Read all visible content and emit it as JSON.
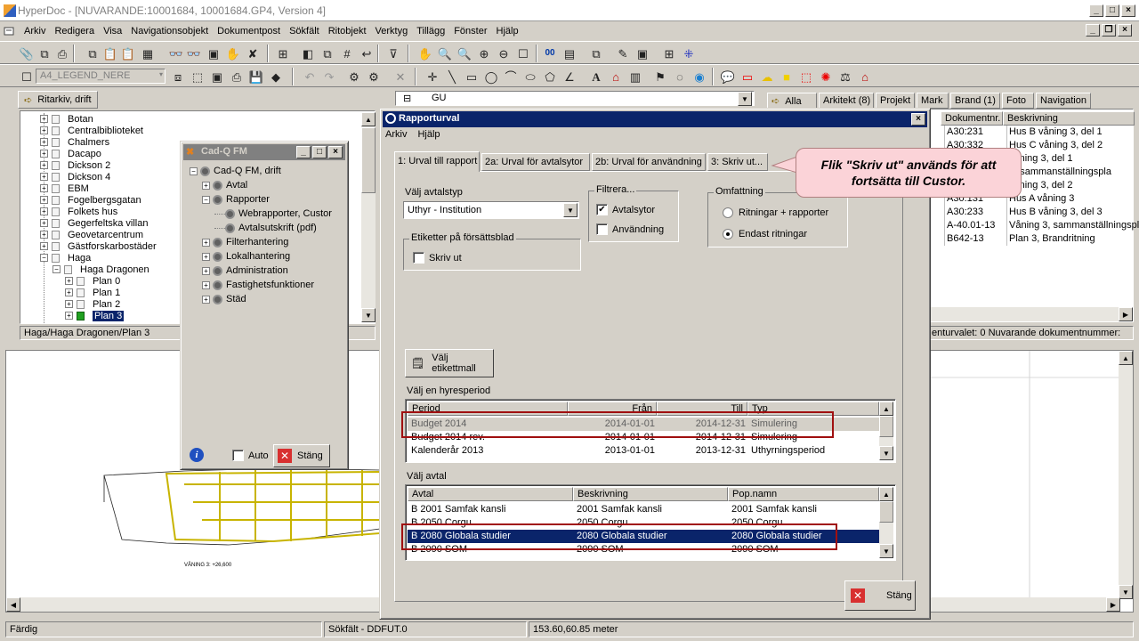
{
  "window": {
    "title": "HyperDoc - [NUVARANDE:10001684, 10001684.GP4, Version 4]"
  },
  "menu": [
    "Arkiv",
    "Redigera",
    "Visa",
    "Navigationsobjekt",
    "Dokumentpost",
    "Sökfält",
    "Ritobjekt",
    "Verktyg",
    "Tillägg",
    "Fönster",
    "Hjälp"
  ],
  "toolbar2": {
    "layer_combo": "A4_LEGEND_NERE"
  },
  "left_panel": {
    "header": "Ritarkiv, drift",
    "tree": [
      {
        "label": "Botan",
        "level": 1
      },
      {
        "label": "Centralbiblioteket",
        "level": 1
      },
      {
        "label": "Chalmers",
        "level": 1
      },
      {
        "label": "Dacapo",
        "level": 1
      },
      {
        "label": "Dickson 2",
        "level": 1
      },
      {
        "label": "Dickson 4",
        "level": 1
      },
      {
        "label": "EBM",
        "level": 1
      },
      {
        "label": "Fogelbergsgatan",
        "level": 1
      },
      {
        "label": "Folkets hus",
        "level": 1
      },
      {
        "label": "Gegerfeltska villan",
        "level": 1
      },
      {
        "label": "Geovetarcentrum",
        "level": 1
      },
      {
        "label": "Gästforskarbostäder",
        "level": 1
      },
      {
        "label": "Haga",
        "level": 1,
        "expanded": true
      },
      {
        "label": "Haga Dragonen",
        "level": 2,
        "expanded": true
      },
      {
        "label": "Plan 0",
        "level": 3
      },
      {
        "label": "Plan 1",
        "level": 3
      },
      {
        "label": "Plan 2",
        "level": 3
      },
      {
        "label": "Plan 3",
        "level": 3,
        "selected": true
      }
    ],
    "status": "Haga/Haga Dragonen/Plan 3"
  },
  "cadq": {
    "title": "Cad-Q FM",
    "tree": [
      {
        "label": "Cad-Q FM, drift",
        "level": 0
      },
      {
        "label": "Avtal",
        "level": 1
      },
      {
        "label": "Rapporter",
        "level": 1
      },
      {
        "label": "Webrapporter, Custor",
        "level": 2
      },
      {
        "label": "Avtalsutskrift (pdf)",
        "level": 2
      },
      {
        "label": "Filterhantering",
        "level": 1
      },
      {
        "label": "Lokalhantering",
        "level": 1
      },
      {
        "label": "Administration",
        "level": 1
      },
      {
        "label": "Fastighetsfunktioner",
        "level": 1
      },
      {
        "label": "Städ",
        "level": 1
      }
    ],
    "auto_label": "Auto",
    "close_label": "Stäng"
  },
  "right_panel": {
    "combo_value": "GU",
    "tabs": [
      "Alla",
      "Arkitekt (8)",
      "Projekt",
      "Mark",
      "Brand (1)",
      "Foto",
      "Navigation"
    ],
    "columns": [
      "Dokumentnr.",
      "Beskrivning"
    ],
    "rows": [
      [
        "A30:231",
        "Hus B våning 3, del 1"
      ],
      [
        "A30:332",
        "Hus C våning 3, del 2"
      ],
      [
        "",
        "våning 3, del 1"
      ],
      [
        "",
        "3, sammanställningspla"
      ],
      [
        "",
        "våning 3, del 2"
      ],
      [
        "A30:131",
        "Hus A våning 3"
      ],
      [
        "A30:233",
        "Hus B våning 3, del 3"
      ],
      [
        "A-40.01-13",
        "Våning 3, sammanställningspl"
      ],
      [
        "B642-13",
        "Plan 3, Brandritning"
      ]
    ],
    "status": "enturvalet: 0   Nuvarande dokumentnummer:"
  },
  "dialog": {
    "title": "Rapporturval",
    "menu": [
      "Arkiv",
      "Hjälp"
    ],
    "tabs": [
      "1: Urval till rapport",
      "2a: Urval för avtalsytor",
      "2b: Urval för användning",
      "3: Skriv ut..."
    ],
    "avtalstyp_label": "Välj avtalstyp",
    "avtalstyp_value": "Uthyr - Institution",
    "filter_label": "Filtrera...",
    "filter_avtalsytor": "Avtalsytor",
    "filter_anvandning": "Användning",
    "omfattning_label": "Omfattning",
    "radio1": "Ritningar + rapporter",
    "radio2": "Endast ritningar",
    "etiketter_label": "Etiketter på försättsblad",
    "etiketter_chk": "Skriv ut",
    "etikettmall_button": "Välj etikettmall",
    "hyresperiod_label": "Välj en hyresperiod",
    "period_columns": [
      "Period",
      "Från",
      "Till",
      "Typ"
    ],
    "periods": [
      [
        "Budget 2014",
        "2014-01-01",
        "2014-12-31",
        "Simulering"
      ],
      [
        "Budget 2014 rev.",
        "2014-01-01",
        "2014-12-31",
        "Simulering"
      ],
      [
        "Kalenderår 2013",
        "2013-01-01",
        "2013-12-31",
        "Uthyrningsperiod"
      ]
    ],
    "avtal_label": "Välj avtal",
    "avtal_columns": [
      "Avtal",
      "Beskrivning",
      "Pop.namn"
    ],
    "avtal": [
      [
        "B 2001 Samfak kansli",
        "2001 Samfak kansli",
        "2001 Samfak kansli"
      ],
      [
        "B 2050 Corgu",
        "2050 Corgu",
        "2050 Corgu"
      ],
      [
        "B 2080 Globala studier",
        "2080 Globala studier",
        "2080 Globala studier"
      ],
      [
        "B 2090 SOM",
        "2090 SOM",
        "2090 SOM"
      ]
    ],
    "close_button": "Stäng"
  },
  "callout": {
    "text": "Flik \"Skriv ut\" används för att fortsätta till Custor."
  },
  "drawing": {
    "level_label": "VÅNING 3: +26,600"
  },
  "status": {
    "ready": "Färdig",
    "sokfalt": "Sökfält - DDFUT.0",
    "coords": "153.60,60.85 meter"
  },
  "colors": {
    "selection": "#0a246a",
    "highlight_box": "#a01010",
    "callout_bg": "#fbd3d8",
    "plan_yellow": "#f2ec3a"
  }
}
